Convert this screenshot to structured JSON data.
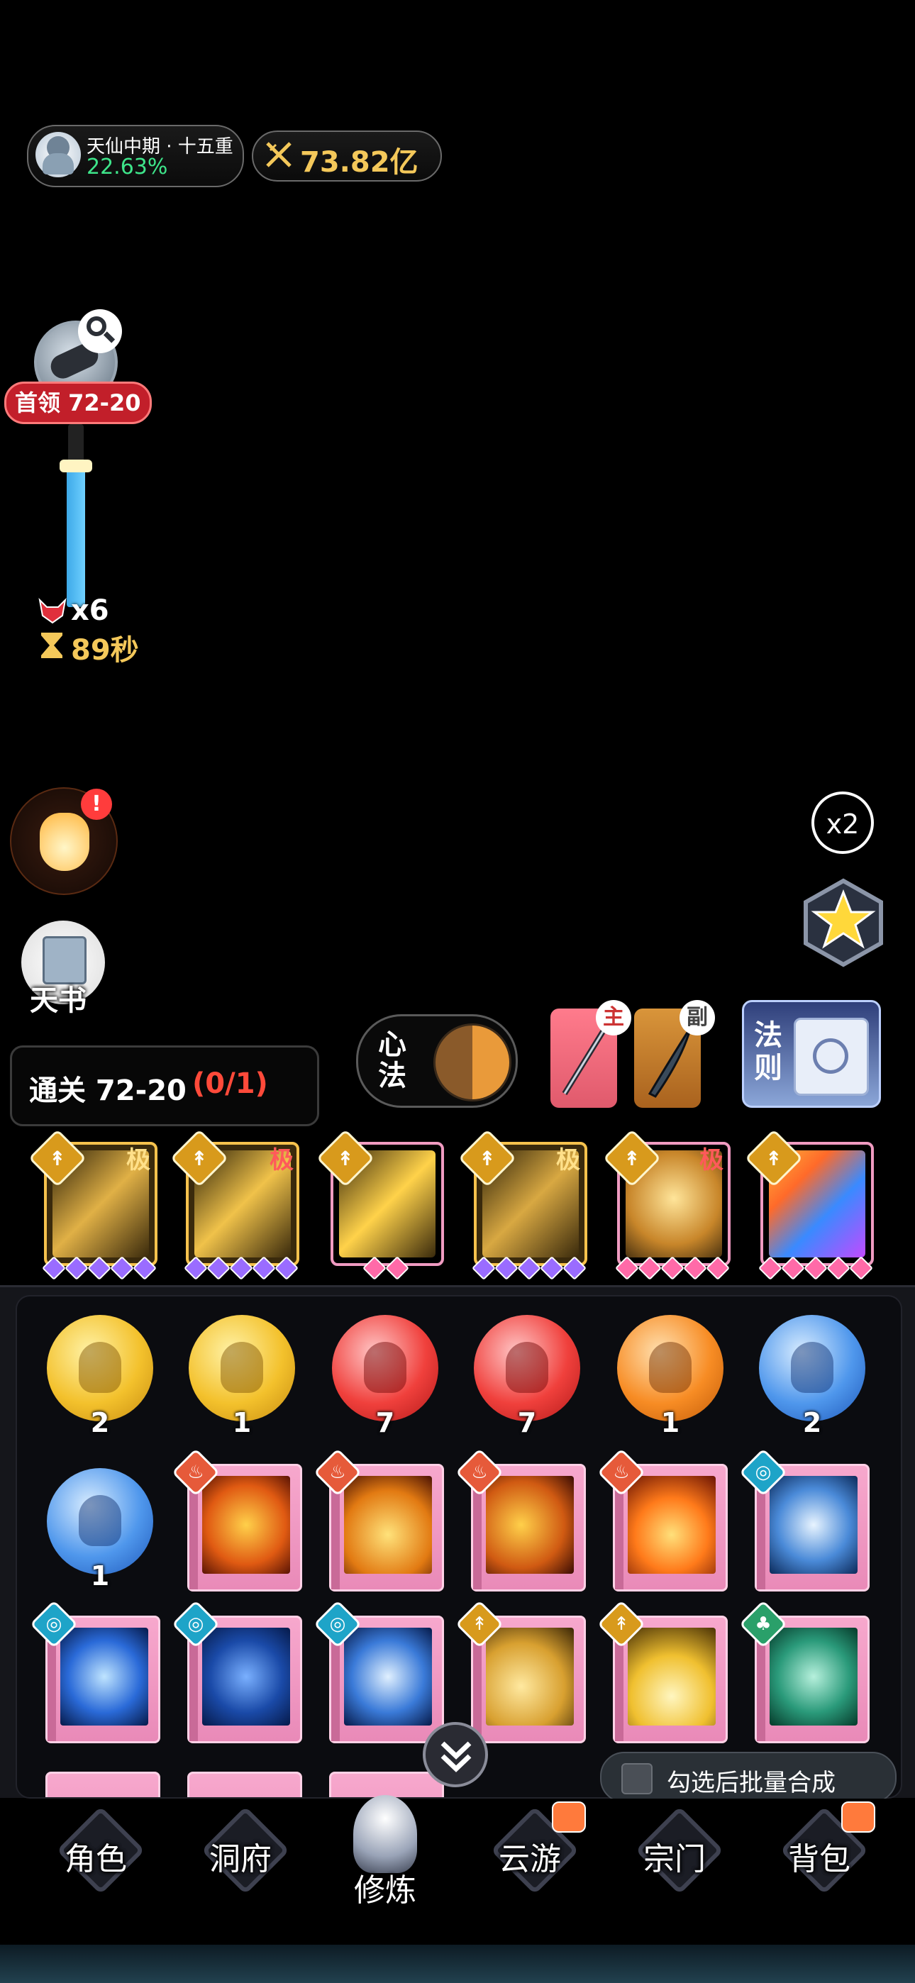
{
  "player": {
    "realm": "天仙中期 · 十五重",
    "progress": "22.63%",
    "power": "73.82亿"
  },
  "boss": {
    "label": "首领 72-20",
    "kills": "x6",
    "timer": "89秒"
  },
  "speed": "x2",
  "tianshu": "天书",
  "stage_label": "通关 72-20",
  "stage_progress": "(0/1)",
  "xinfa": "心法",
  "weapon_main": "主",
  "weapon_sub": "副",
  "fa_ze": "法则",
  "grade_ji": "极",
  "orbs": [
    {
      "count": "2",
      "color": "gold"
    },
    {
      "count": "1",
      "color": "gold"
    },
    {
      "count": "7",
      "color": "red"
    },
    {
      "count": "7",
      "color": "red"
    },
    {
      "count": "1",
      "color": "orange"
    },
    {
      "count": "2",
      "color": "blue"
    },
    {
      "count": "1",
      "color": "blue"
    }
  ],
  "merge_label": "勾选后批量合成",
  "nav": [
    "角色",
    "洞府",
    "修炼",
    "云游",
    "宗门",
    "背包"
  ],
  "colors": {
    "accent_green": "#3ee58a",
    "power_gold": "#f4c85a",
    "boss_red": "#c21f2a",
    "stage_red": "#ff4a3a",
    "card_pink": "#f09bc1"
  }
}
